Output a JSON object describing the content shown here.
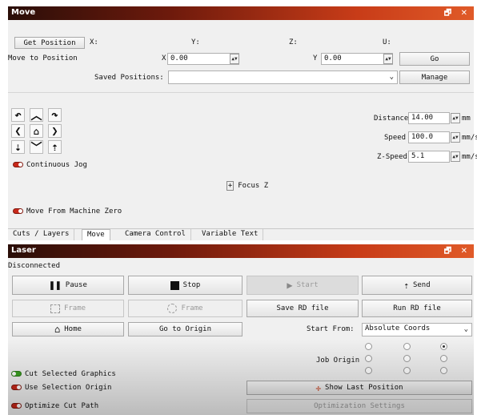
{
  "move": {
    "title": "Move",
    "window_controls": "🗗 ✕",
    "get_position": "Get Position",
    "x_label": "X:",
    "y_label": "Y:",
    "z_label": "Z:",
    "u_label": "U:",
    "move_to_position": "Move to Position",
    "x_field_label": "X",
    "x_value": "0.00",
    "y_field_label": "Y",
    "y_value": "0.00",
    "go": "Go",
    "saved_positions_label": "Saved Positions:",
    "saved_positions_value": "",
    "manage": "Manage",
    "continuous_jog": "Continuous Jog",
    "distance_label": "Distance",
    "distance_value": "14.00",
    "distance_unit": "mm",
    "speed_label": "Speed",
    "speed_value": "100.0",
    "speed_unit": "mm/s",
    "zspeed_label": "Z-Speed",
    "zspeed_value": "5.1",
    "zspeed_unit": "mm/s",
    "focus_z": "Focus Z",
    "move_from_machine_zero": "Move From Machine Zero"
  },
  "tabs": [
    "Cuts / Layers",
    "Move",
    "Camera Control",
    "Variable Text"
  ],
  "active_tab": "Move",
  "laser": {
    "title": "Laser",
    "window_controls": "🗗 ✕",
    "status": "Disconnected",
    "pause": "Pause",
    "stop": "Stop",
    "start": "Start",
    "send": "Send",
    "frame1": "Frame",
    "frame2": "Frame",
    "save_rd": "Save RD file",
    "run_rd": "Run RD file",
    "home": "Home",
    "go_to_origin": "Go to Origin",
    "start_from_label": "Start From:",
    "start_from_value": "Absolute Coords",
    "job_origin_label": "Job Origin",
    "job_origin_selected": 2,
    "cut_selected_graphics": "Cut Selected Graphics",
    "use_selection_origin": "Use Selection Origin",
    "optimize_cut_path": "Optimize Cut Path",
    "show_last_position": "Show Last Position",
    "optimization_settings": "Optimization Settings"
  },
  "colors": {
    "title_gradient_start": "#2a0e08",
    "title_gradient_end": "#e05a28",
    "toggle_on": "#3aa020",
    "toggle_off": "#c8281a"
  }
}
